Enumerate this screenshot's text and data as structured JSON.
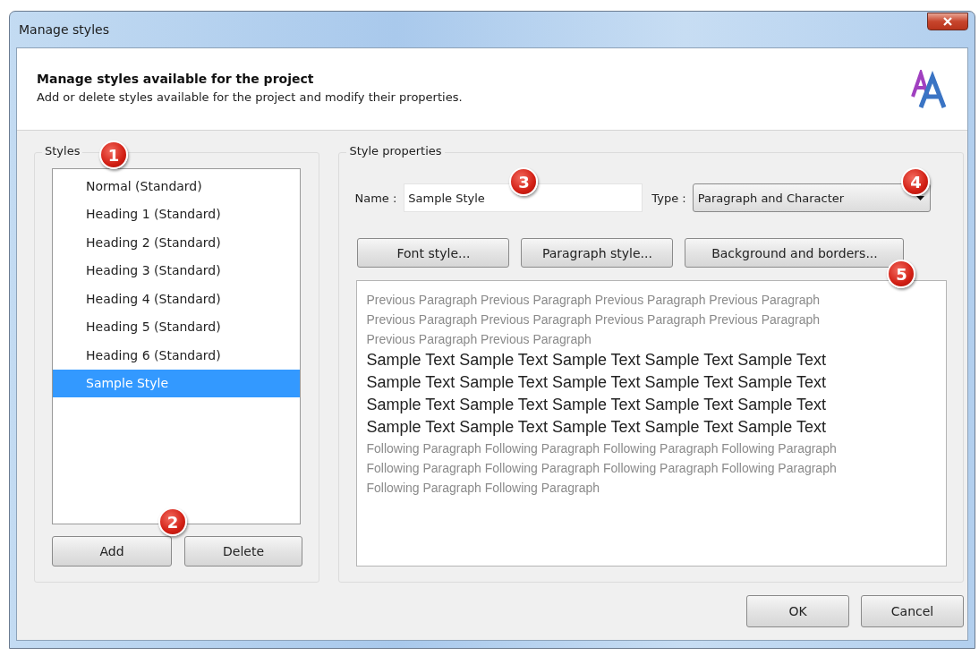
{
  "window": {
    "title": "Manage styles"
  },
  "header": {
    "title": "Manage styles available for the project",
    "subtitle": "Add or delete styles available for the project and modify their properties."
  },
  "styles_group": {
    "label": "Styles",
    "items": [
      {
        "label": "Normal (Standard)",
        "selected": false
      },
      {
        "label": "Heading 1 (Standard)",
        "selected": false
      },
      {
        "label": "Heading 2 (Standard)",
        "selected": false
      },
      {
        "label": "Heading 3 (Standard)",
        "selected": false
      },
      {
        "label": "Heading 4 (Standard)",
        "selected": false
      },
      {
        "label": "Heading 5 (Standard)",
        "selected": false
      },
      {
        "label": "Heading 6 (Standard)",
        "selected": false
      },
      {
        "label": "Sample Style",
        "selected": true
      }
    ],
    "buttons": [
      "Add",
      "Delete"
    ]
  },
  "properties_group": {
    "label": "Style properties",
    "name_label": "Name :",
    "name_value": "Sample Style",
    "type_label": "Type :",
    "type_value": "Paragraph and Character",
    "buttons": [
      "Font style...",
      "Paragraph style...",
      "Background and borders..."
    ],
    "preview": [
      {
        "kind": "previous",
        "text": "Previous Paragraph Previous Paragraph Previous Paragraph Previous Paragraph"
      },
      {
        "kind": "previous",
        "text": "Previous Paragraph Previous Paragraph Previous Paragraph Previous Paragraph"
      },
      {
        "kind": "previous",
        "text": "Previous Paragraph Previous Paragraph"
      },
      {
        "kind": "sample",
        "text": "Sample Text Sample Text Sample Text Sample Text Sample Text"
      },
      {
        "kind": "sample",
        "text": "Sample Text Sample Text Sample Text Sample Text Sample Text"
      },
      {
        "kind": "sample",
        "text": "Sample Text Sample Text Sample Text Sample Text Sample Text"
      },
      {
        "kind": "sample",
        "text": "Sample Text Sample Text Sample Text Sample Text Sample Text"
      },
      {
        "kind": "following",
        "text": "Following Paragraph Following Paragraph Following Paragraph Following Paragraph"
      },
      {
        "kind": "following",
        "text": "Following Paragraph Following Paragraph Following Paragraph Following Paragraph"
      },
      {
        "kind": "following",
        "text": "Following Paragraph Following Paragraph"
      }
    ]
  },
  "callouts": [
    "1",
    "2",
    "3",
    "4",
    "5"
  ],
  "footer_buttons": [
    "OK",
    "Cancel"
  ]
}
